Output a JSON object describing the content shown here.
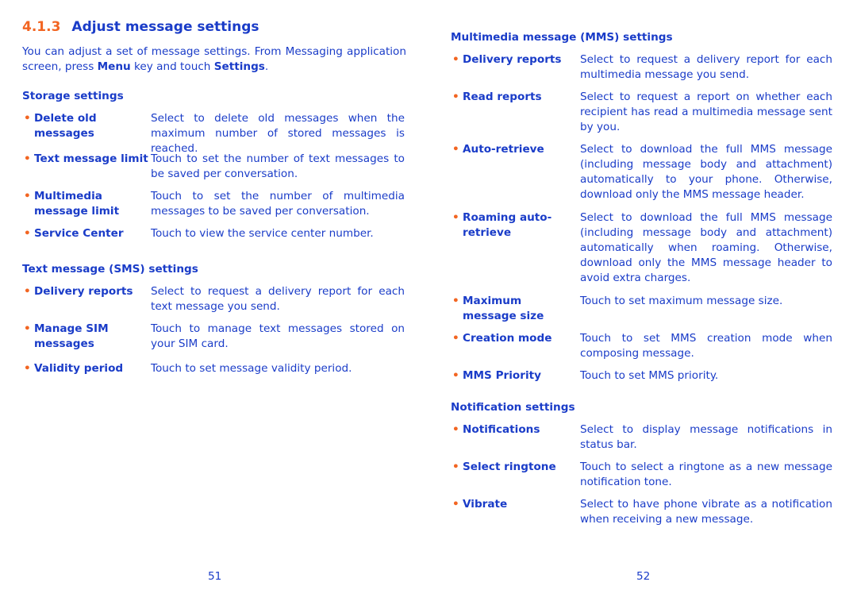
{
  "section": {
    "number": "4.1.3",
    "title": "Adjust message settings"
  },
  "intro": {
    "text1": "You can adjust a set of message settings. From Messaging application screen, press ",
    "menu": "Menu",
    "text2": " key and touch ",
    "settings": "Settings",
    "text3": "."
  },
  "colors": {
    "text": "#1a3cc8",
    "accent": "#f26522"
  },
  "left": {
    "groups": [
      {
        "heading": "Storage settings",
        "items": [
          {
            "term": "Delete old messages",
            "desc": "Select to delete old messages when the maximum number of stored messages is reached."
          },
          {
            "term": "Text message limit",
            "desc": "Touch to set the number of text messages to be saved per conversation."
          },
          {
            "term": "Multimedia message limit",
            "desc": "Touch to set the number of multimedia messages to be saved per conversation."
          },
          {
            "term": "Service Center",
            "desc": "Touch to view the service center number."
          }
        ]
      },
      {
        "heading": "Text message (SMS) settings",
        "items": [
          {
            "term": "Delivery reports",
            "desc": "Select to request a delivery report for each text message you send."
          },
          {
            "term": "Manage SIM messages",
            "desc": "Touch to manage text messages stored on your SIM card."
          },
          {
            "term": "Validity period",
            "desc": "Touch to set message validity period."
          }
        ]
      }
    ],
    "page_number": "51"
  },
  "right": {
    "groups": [
      {
        "heading": "Multimedia message (MMS) settings",
        "items": [
          {
            "term": "Delivery reports",
            "desc": "Select to request a delivery report for each multimedia message you send."
          },
          {
            "term": "Read reports",
            "desc": "Select to request a report on whether each recipient has read a multimedia message sent by you."
          },
          {
            "term": "Auto-retrieve",
            "desc": "Select to download the full MMS message (including message body and attachment) automatically to your phone. Otherwise, download only the MMS message header."
          },
          {
            "term": "Roaming auto-retrieve",
            "desc": "Select to download the full MMS message (including message body and attachment) automatically when roaming. Otherwise, download only the MMS message header to avoid extra charges."
          },
          {
            "term": "Maximum message size",
            "desc": "Touch to set maximum message size."
          },
          {
            "term": "Creation mode",
            "desc": "Touch to set MMS creation mode when composing message."
          },
          {
            "term": "MMS Priority",
            "desc": "Touch to set MMS priority."
          }
        ]
      },
      {
        "heading": "Notification settings",
        "items": [
          {
            "term": "Notifications",
            "desc": "Select to display message notifications in status bar."
          },
          {
            "term": "Select ringtone",
            "desc": "Touch to select a ringtone as a new message notification tone."
          },
          {
            "term": "Vibrate",
            "desc": "Select to have phone vibrate as a notification when receiving a new message."
          }
        ]
      }
    ],
    "page_number": "52"
  }
}
